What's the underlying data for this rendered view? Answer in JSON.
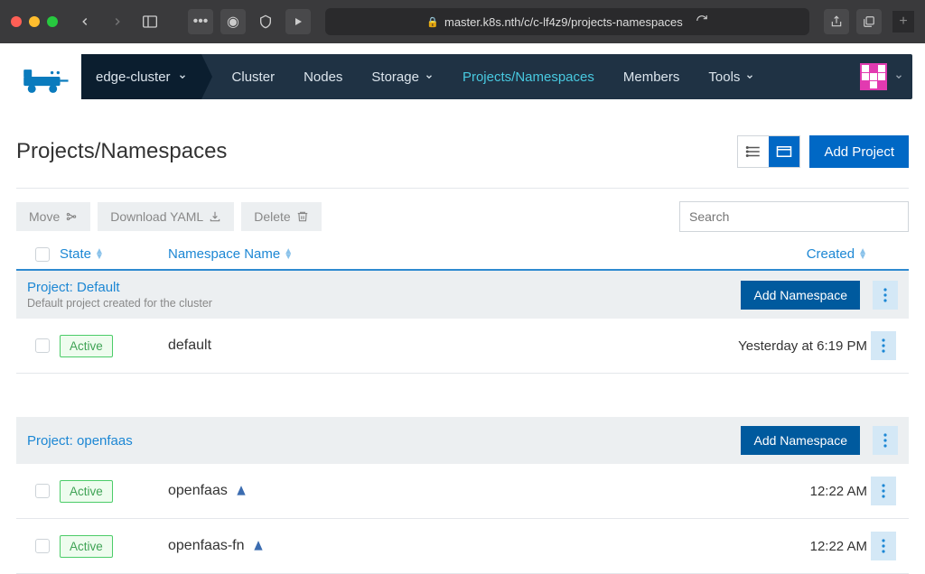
{
  "browser": {
    "url": "master.k8s.nth/c/c-lf4z9/projects-namespaces"
  },
  "nav": {
    "cluster_name": "edge-cluster",
    "items": [
      "Cluster",
      "Nodes",
      "Storage",
      "Projects/Namespaces",
      "Members",
      "Tools"
    ],
    "active_index": 3
  },
  "page": {
    "title": "Projects/Namespaces",
    "add_project": "Add Project"
  },
  "toolbar": {
    "move": "Move",
    "download": "Download YAML",
    "delete": "Delete",
    "search_placeholder": "Search"
  },
  "columns": {
    "state": "State",
    "name": "Namespace Name",
    "created": "Created"
  },
  "projects": [
    {
      "title": "Project: Default",
      "description": "Default project created for the cluster",
      "add_namespace": "Add Namespace",
      "namespaces": [
        {
          "state": "Active",
          "name": "default",
          "helm": false,
          "created": "Yesterday at 6:19 PM"
        }
      ]
    },
    {
      "title": "Project: openfaas",
      "description": "",
      "add_namespace": "Add Namespace",
      "namespaces": [
        {
          "state": "Active",
          "name": "openfaas",
          "helm": true,
          "created": "12:22 AM"
        },
        {
          "state": "Active",
          "name": "openfaas-fn",
          "helm": true,
          "created": "12:22 AM"
        }
      ]
    }
  ]
}
